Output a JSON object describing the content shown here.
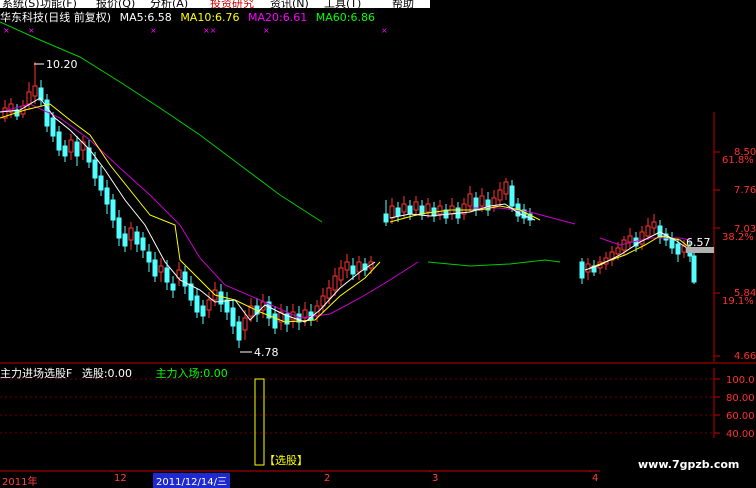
{
  "menu": [
    "系统(S)",
    "功能(F)",
    "报价(Q)",
    "分析(A)",
    "投资研究",
    "资讯(N)",
    "工具(T)",
    "帮助"
  ],
  "header": {
    "stock_name": "华东科技",
    "mode": "(日线 前复权)",
    "ma5": "MA5:6.58",
    "ma10": "MA10:6.76",
    "ma20": "MA20:6.61",
    "ma60": "MA60:6.86"
  },
  "price_labels": {
    "high": "10.20",
    "low": "4.78",
    "current": "6.57"
  },
  "right_axis": [
    {
      "price": "8.50",
      "pct": "61.8%"
    },
    {
      "price": "7.76",
      "pct": ""
    },
    {
      "price": "7.03",
      "pct": "38.2%"
    },
    {
      "price": "5.84",
      "pct": "19.1%"
    },
    {
      "price": "4.66",
      "pct": ""
    }
  ],
  "indicator": {
    "name": "主力进场选股F",
    "value1": "选股:0.00",
    "value2": "主力入场:0.00",
    "axis": [
      "100.0",
      "80.00",
      "60.00",
      "40.00"
    ],
    "signal_label": "【选股】"
  },
  "timebar": {
    "labels": [
      "2011年",
      "12",
      "2",
      "3",
      "4"
    ],
    "cursor_date": "2011/12/14/三"
  },
  "watermark": "www.7gpzb.com",
  "colors": {
    "up": "#ff3232",
    "down": "#54ffff",
    "ma5": "#ffffff",
    "ma10": "#ffff00",
    "ma20": "#ff00ff",
    "ma60": "#00ff00",
    "axis": "#c00000"
  }
}
